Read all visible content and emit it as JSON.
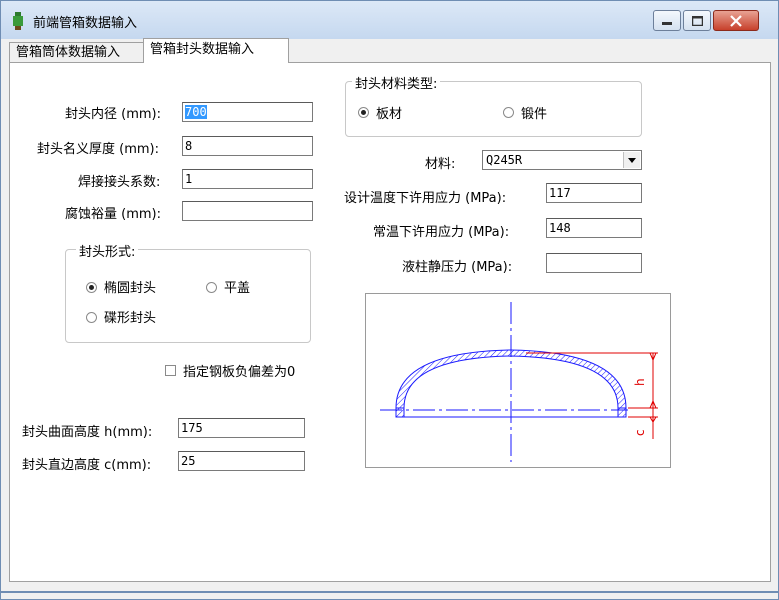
{
  "window": {
    "title": "前端管箱数据输入"
  },
  "tabs": [
    {
      "label": "管箱筒体数据输入"
    },
    {
      "label": "管箱封头数据输入"
    }
  ],
  "left": {
    "inner_diameter": {
      "label": "封头内径 (mm):",
      "value": "700"
    },
    "nominal_thickness": {
      "label": "封头名义厚度 (mm):",
      "value": "8"
    },
    "weld_coeff": {
      "label": "焊接接头系数:",
      "value": "1"
    },
    "corrosion": {
      "label": "腐蚀裕量 (mm):",
      "value": ""
    },
    "head_form": {
      "title": "封头形式:",
      "options": [
        {
          "label": "椭圆封头"
        },
        {
          "label": "平盖"
        },
        {
          "label": "碟形封头"
        }
      ]
    },
    "zero_tolerance": {
      "label": "指定钢板负偏差为0"
    },
    "curve_height": {
      "label": "封头曲面高度 h(mm):",
      "value": "175"
    },
    "straight_height": {
      "label": "封头直边高度 c(mm):",
      "value": "25"
    }
  },
  "right": {
    "material_type": {
      "title": "封头材料类型:",
      "options": [
        {
          "label": "板材"
        },
        {
          "label": "锻件"
        }
      ]
    },
    "material": {
      "label": "材料:",
      "value": "Q245R"
    },
    "allow_stress_design": {
      "label": "设计温度下许用应力 (MPa):",
      "value": "117"
    },
    "allow_stress_room": {
      "label": "常温下许用应力 (MPa):",
      "value": "148"
    },
    "liquid_pressure": {
      "label": "液柱静压力 (MPa):",
      "value": ""
    },
    "diagram_labels": {
      "h": "h",
      "c": "c"
    }
  },
  "colors": {
    "title_bg": "#c5d8ef",
    "selection": "#3399ff",
    "diagram_blue": "#1a1aff",
    "diagram_red": "#e00000"
  }
}
